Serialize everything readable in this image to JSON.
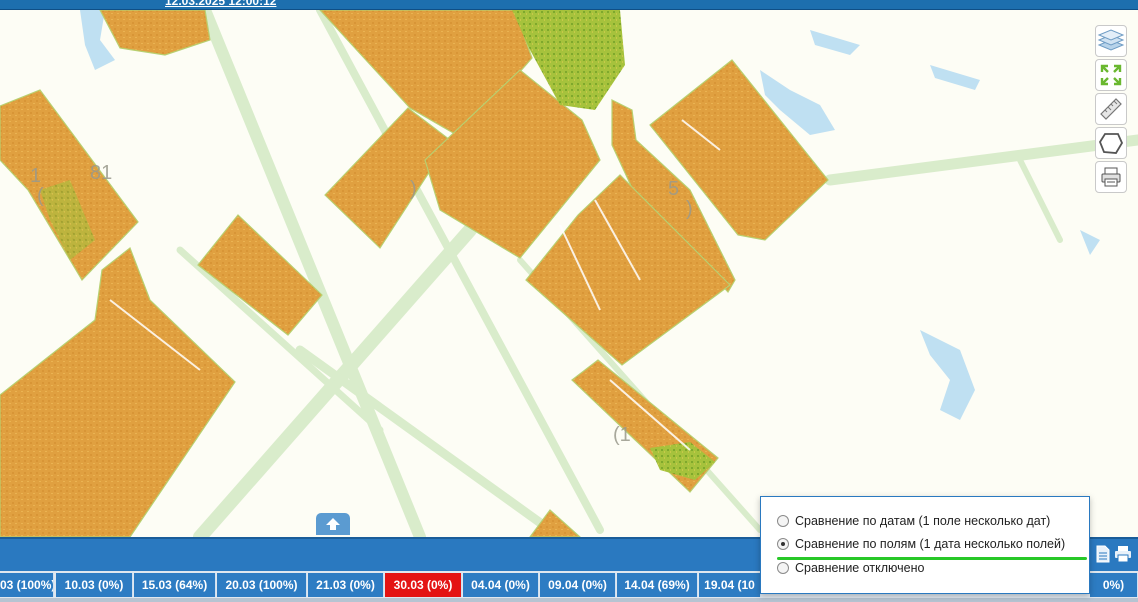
{
  "header": {
    "partial_text": "12.03.2025 12:00:12"
  },
  "map": {
    "field_labels": [
      "1",
      "81",
      "(",
      ")",
      "5",
      ")",
      "(1"
    ],
    "colors": {
      "field_orange": "#e3a33f",
      "field_green": "#9cbf3a",
      "roads": "#d8ecc8",
      "water": "#b8dcf0",
      "background": "#fdfdf5"
    }
  },
  "tools": {
    "items": [
      "layers-icon",
      "fullscreen-icon",
      "ruler-icon",
      "polygon-icon",
      "print-settings-icon"
    ]
  },
  "bottom_bar": {
    "icons": [
      "document-icon",
      "print-icon"
    ]
  },
  "timeline": {
    "dates": [
      {
        "label": "03 (100%)",
        "active": false
      },
      {
        "label": "10.03 (0%)",
        "active": false
      },
      {
        "label": "15.03 (64%)",
        "active": false
      },
      {
        "label": "20.03 (100%)",
        "active": false
      },
      {
        "label": "21.03 (0%)",
        "active": false
      },
      {
        "label": "30.03 (0%)",
        "active": true
      },
      {
        "label": "04.04 (0%)",
        "active": false
      },
      {
        "label": "09.04 (0%)",
        "active": false
      },
      {
        "label": "14.04 (69%)",
        "active": false
      },
      {
        "label": "19.04 (10",
        "active": false
      },
      {
        "label": "0%)",
        "active": false
      }
    ]
  },
  "comparison_popup": {
    "options": [
      {
        "label": "Сравнение по датам (1 поле несколько дат)",
        "checked": false
      },
      {
        "label": "Сравнение по полям (1 дата несколько полей)",
        "checked": true
      },
      {
        "label": "Сравнение отключено",
        "checked": false
      }
    ],
    "highlight_color": "#28c828"
  }
}
